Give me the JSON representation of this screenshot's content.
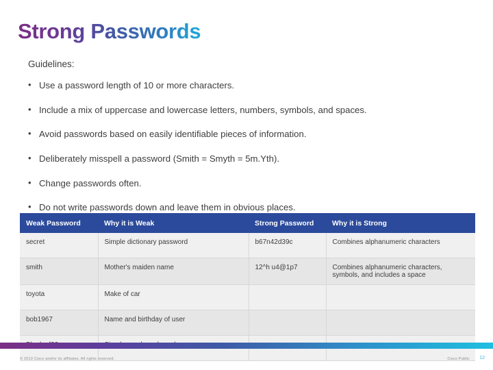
{
  "slide": {
    "title": "Strong Passwords",
    "section_label": "Guidelines:",
    "bullet_marker": "•",
    "bullets": [
      "Use a password length of 10 or more characters.",
      "Include a mix of uppercase and lowercase letters, numbers, symbols, and spaces.",
      "Avoid passwords based on easily identifiable pieces of information.",
      "Deliberately misspell a password (Smith = Smyth = 5m.Yth).",
      "Change passwords often.",
      "Do not write passwords down and leave them in obvious places."
    ],
    "table": {
      "headers": [
        "Weak Password",
        "Why it is Weak",
        "Strong Password",
        "Why it is Strong"
      ],
      "rows": [
        [
          "secret",
          "Simple dictionary password",
          "b67n42d39c",
          "Combines alphanumeric characters"
        ],
        [
          "smith",
          "Mother's maiden name",
          "12^h u4@1p7",
          "Combines alphanumeric characters, symbols, and includes a space"
        ],
        [
          "toyota",
          "Make of car",
          "",
          ""
        ],
        [
          "bob1967",
          "Name and birthday of user",
          "",
          ""
        ],
        [
          "Blueleaf23",
          "Simple words and numbers",
          "",
          ""
        ]
      ]
    },
    "footer": {
      "copyright": "© 2013 Cisco and/or its affiliates. All rights reserved.",
      "confidentiality": "Cisco Public",
      "page_number": "12"
    },
    "colors": {
      "header_blue": "#2b4a9b",
      "accent_gradient_start": "#7b2f86",
      "accent_gradient_end": "#1fbfe0",
      "page_number": "#38b6dd"
    }
  }
}
